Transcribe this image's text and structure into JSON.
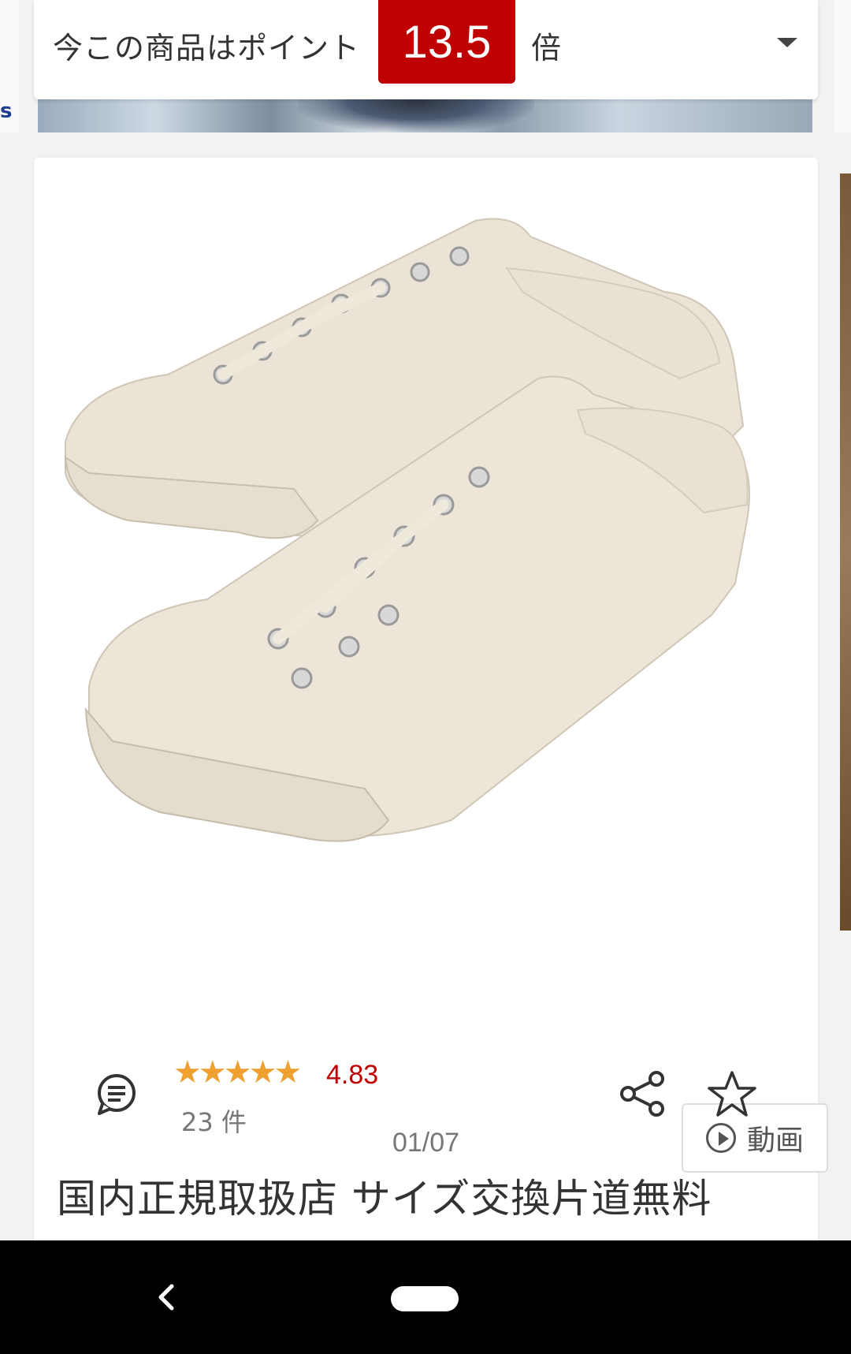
{
  "points": {
    "prefix": "今この商品はポイント",
    "multiplier": "13.5",
    "suffix": "倍",
    "accent_color": "#bf0000"
  },
  "gallery": {
    "counter": "01/07",
    "video_label": "動画",
    "video_icon": "play-circle-icon"
  },
  "rating": {
    "stars": "★★★★★",
    "value": "4.83",
    "count": "23 件",
    "star_color": "#f0a030"
  },
  "actions": {
    "review_icon": "chat-bubble-icon",
    "share_icon": "share-icon",
    "favorite_icon": "star-outline-icon"
  },
  "product": {
    "title": "国内正規取扱店 サイズ交換片道無料"
  },
  "system_nav": {
    "back_icon": "back-chevron-icon",
    "home_icon": "home-pill-icon"
  }
}
